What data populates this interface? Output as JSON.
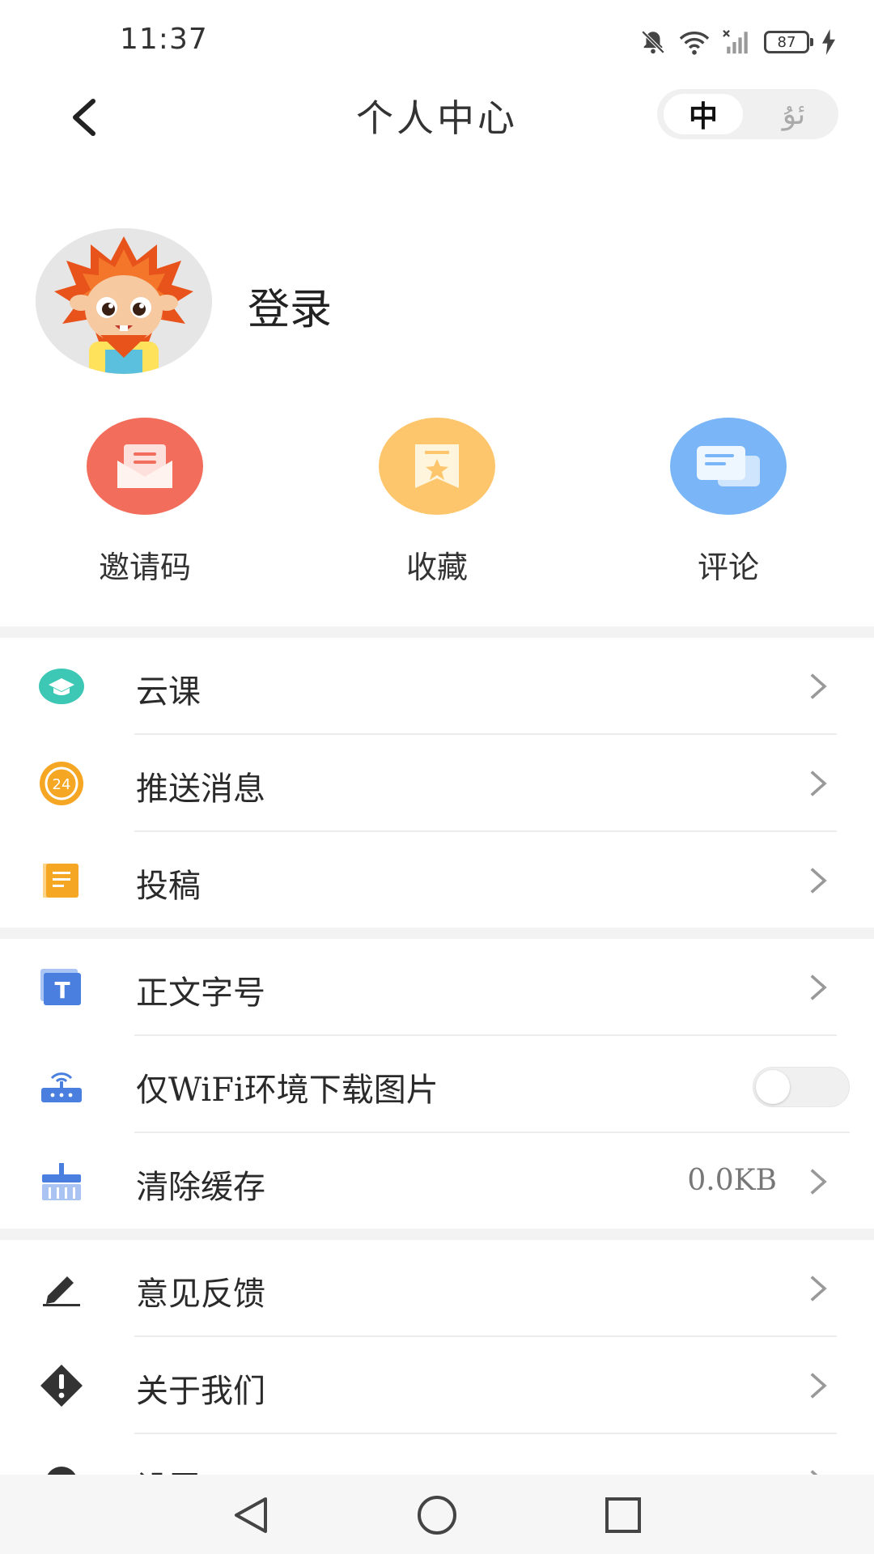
{
  "status_bar": {
    "time": "11:37",
    "battery": "87"
  },
  "header": {
    "title": "个人中心",
    "lang_zh": "中",
    "lang_ug": "ئۇ"
  },
  "profile": {
    "login_label": "登录"
  },
  "quick_actions": [
    {
      "label": "邀请码",
      "color": "#f26d5b"
    },
    {
      "label": "收藏",
      "color": "#fdc66c"
    },
    {
      "label": "评论",
      "color": "#7ab6f7"
    }
  ],
  "menu": {
    "group1": [
      {
        "label": "云课",
        "icon": "graduation-cap-icon"
      },
      {
        "label": "推送消息",
        "icon": "clock-24-icon",
        "icon_text": "24"
      },
      {
        "label": "投稿",
        "icon": "notebook-icon"
      }
    ],
    "group2": [
      {
        "label": "正文字号",
        "icon": "text-size-icon",
        "icon_text": "T"
      },
      {
        "label": "仅WiFi环境下载图片",
        "icon": "router-icon",
        "toggle_on": false
      },
      {
        "label": "清除缓存",
        "icon": "broom-icon",
        "value": "0.0KB"
      }
    ],
    "group3": [
      {
        "label": "意见反馈",
        "icon": "pencil-icon"
      },
      {
        "label": "关于我们",
        "icon": "warning-diamond-icon"
      },
      {
        "label": "设置",
        "icon": "settings-icon"
      }
    ]
  },
  "colors": {
    "accent_teal": "#3cc8b4",
    "accent_orange": "#f5a623",
    "accent_blue": "#4a7fe0"
  }
}
